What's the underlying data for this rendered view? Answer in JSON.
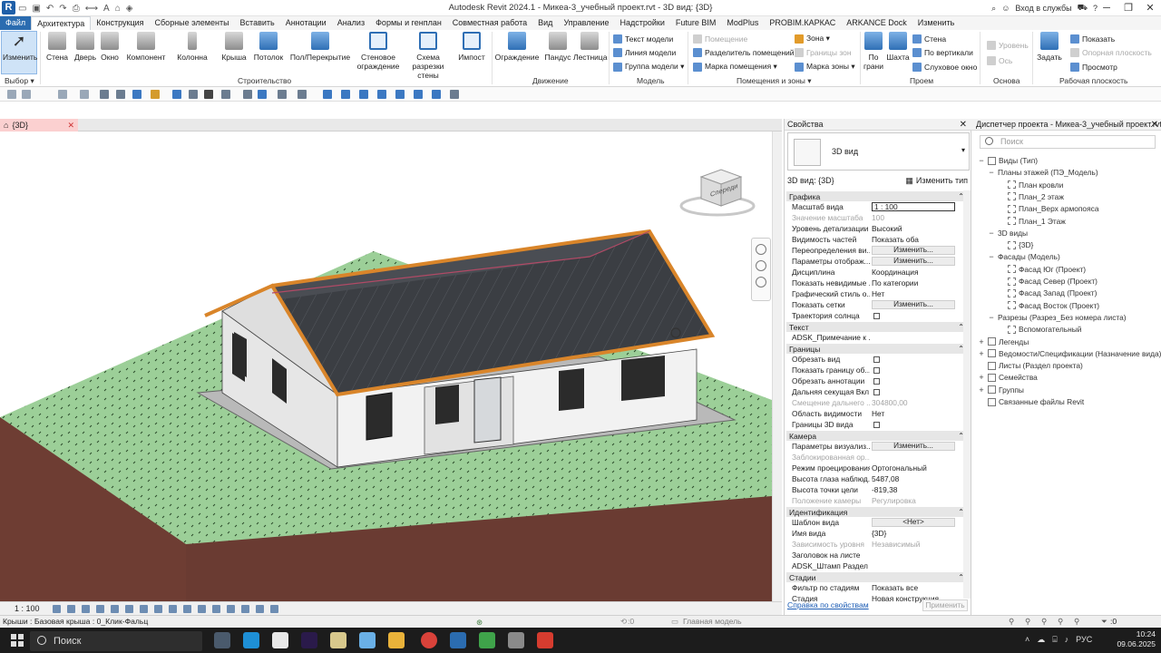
{
  "app": {
    "title": "Autodesk Revit 2024.1 - Микеа-3_учебный проект.rvt - 3D вид: {3D}",
    "logo": "R",
    "login": "Вход в службы",
    "help": "?"
  },
  "tabs": [
    "Файл",
    "Архитектура",
    "Конструкция",
    "Сборные элементы",
    "Вставить",
    "Аннотации",
    "Анализ",
    "Формы и генплан",
    "Совместная работа",
    "Вид",
    "Управление",
    "Надстройки",
    "Future BIM",
    "ModPlus",
    "PROBIM.КАРКАС",
    "ARKANCE Dock",
    "Изменить"
  ],
  "ribbon": {
    "select": {
      "modify": "Изменить",
      "select": "Выбор ▾"
    },
    "build": {
      "label": "Строительство",
      "buttons": [
        "Стена",
        "Дверь",
        "Окно",
        "Компонент",
        "Колонна",
        "Крыша",
        "Потолок",
        "Пол/Перекрытие",
        "Стеновое ограждение",
        "Схема разрезки стены",
        "Импост"
      ]
    },
    "circulation": {
      "label": "Движение",
      "buttons": [
        "Ограждение",
        "Пандус",
        "Лестница"
      ]
    },
    "model": {
      "label": "Модель",
      "items": [
        "Текст модели",
        "Линия модели",
        "Группа модели ▾"
      ]
    },
    "rooms": {
      "label": "Помещения и зоны ▾",
      "items": [
        "Помещение",
        "Разделитель помещений",
        "Марка помещения ▾",
        "Зона ▾",
        "Границы зон",
        "Марка зоны ▾"
      ]
    },
    "opening": {
      "label": "Проем",
      "bigbuttons": [
        "По грани",
        "Шахта"
      ],
      "items": [
        "Стена",
        "По вертикали",
        "Слуховое окно"
      ]
    },
    "datum": {
      "label": "Основа",
      "items": [
        "Уровень",
        "Ось"
      ]
    },
    "workplane": {
      "label": "Рабочая плоскость",
      "set": "Задать",
      "items": [
        "Показать",
        "Опорная плоскость",
        "Просмотр"
      ]
    }
  },
  "viewtab": {
    "label": "{3D}"
  },
  "viewcube": {
    "face": "Спереди"
  },
  "viewcontrol": {
    "scale": "1 : 100"
  },
  "properties": {
    "title": "Свойства",
    "type_name": "3D вид",
    "view_selector": "3D вид: {3D}",
    "edit_type": "Изменить тип",
    "sections": [
      {
        "name": "Графика",
        "rows": [
          {
            "n": "Масштаб вида",
            "v": "1 : 100",
            "k": "input"
          },
          {
            "n": "Значение масштаба",
            "v": "100",
            "k": "dis"
          },
          {
            "n": "Уровень детализации",
            "v": "Высокий",
            "k": "text"
          },
          {
            "n": "Видимость частей",
            "v": "Показать оба",
            "k": "text"
          },
          {
            "n": "Переопределения ви...",
            "v": "Изменить...",
            "k": "btn"
          },
          {
            "n": "Параметры отображ...",
            "v": "Изменить...",
            "k": "btn"
          },
          {
            "n": "Дисциплина",
            "v": "Координация",
            "k": "text"
          },
          {
            "n": "Показать невидимые ...",
            "v": "По категории",
            "k": "text"
          },
          {
            "n": "Графический стиль о...",
            "v": "Нет",
            "k": "text"
          },
          {
            "n": "Показать сетки",
            "v": "Изменить...",
            "k": "btn"
          },
          {
            "n": "Траектория солнца",
            "v": "",
            "k": "cb"
          }
        ]
      },
      {
        "name": "Текст",
        "rows": [
          {
            "n": "ADSK_Примечание к ...",
            "v": "",
            "k": "text"
          }
        ]
      },
      {
        "name": "Границы",
        "rows": [
          {
            "n": "Обрезать вид",
            "v": "",
            "k": "cb"
          },
          {
            "n": "Показать границу об...",
            "v": "",
            "k": "cb"
          },
          {
            "n": "Обрезать аннотации",
            "v": "",
            "k": "cb"
          },
          {
            "n": "Дальняя секущая Вкл",
            "v": "",
            "k": "cb"
          },
          {
            "n": "Смещение дальнего ...",
            "v": "304800,00",
            "k": "dis"
          },
          {
            "n": "Область видимости",
            "v": "Нет",
            "k": "text"
          },
          {
            "n": "Границы 3D вида",
            "v": "",
            "k": "cb"
          }
        ]
      },
      {
        "name": "Камера",
        "rows": [
          {
            "n": "Параметры визуализ...",
            "v": "Изменить...",
            "k": "btn"
          },
          {
            "n": "Заблокированная ор...",
            "v": "",
            "k": "dis"
          },
          {
            "n": "Режим проецирования",
            "v": "Ортогональный",
            "k": "text"
          },
          {
            "n": "Высота глаза наблюд...",
            "v": "5487,08",
            "k": "text"
          },
          {
            "n": "Высота точки цели",
            "v": "-819,38",
            "k": "text"
          },
          {
            "n": "Положение камеры",
            "v": "Регулировка",
            "k": "dis"
          }
        ]
      },
      {
        "name": "Идентификация",
        "rows": [
          {
            "n": "Шаблон вида",
            "v": "<Нет>",
            "k": "btn"
          },
          {
            "n": "Имя вида",
            "v": "{3D}",
            "k": "text"
          },
          {
            "n": "Зависимость уровня",
            "v": "Независимый",
            "k": "dis"
          },
          {
            "n": "Заголовок на листе",
            "v": "",
            "k": "text"
          },
          {
            "n": "ADSK_Штамп Раздел ...",
            "v": "",
            "k": "text"
          }
        ]
      },
      {
        "name": "Стадии",
        "rows": [
          {
            "n": "Фильтр по стадиям",
            "v": "Показать все",
            "k": "text"
          },
          {
            "n": "Стадия",
            "v": "Новая конструкция",
            "k": "text"
          }
        ]
      }
    ],
    "help_link": "Справка по свойствам",
    "apply": "Применить"
  },
  "browser": {
    "title": "Диспетчер проекта - Микеа-3_учебный проект.rvt",
    "search_placeholder": "Поиск",
    "nodes": [
      {
        "t": "Виды (Тип)",
        "lvl": 0,
        "tg": "−",
        "ic": true
      },
      {
        "t": "Планы этажей (ПЭ_Модель)",
        "lvl": 1,
        "tg": "−",
        "ic": false
      },
      {
        "t": "План кровли",
        "lvl": 2,
        "tg": "",
        "ic": true
      },
      {
        "t": "План_2 этаж",
        "lvl": 2,
        "tg": "",
        "ic": true
      },
      {
        "t": "План_Верх армопояса",
        "lvl": 2,
        "tg": "",
        "ic": true
      },
      {
        "t": "План_1 Этаж",
        "lvl": 2,
        "tg": "",
        "ic": true
      },
      {
        "t": "3D виды",
        "lvl": 1,
        "tg": "−",
        "ic": false
      },
      {
        "t": "{3D}",
        "lvl": 2,
        "tg": "",
        "ic": true
      },
      {
        "t": "Фасады (Модель)",
        "lvl": 1,
        "tg": "−",
        "ic": false
      },
      {
        "t": "Фасад Юг (Проект)",
        "lvl": 2,
        "tg": "",
        "ic": true
      },
      {
        "t": "Фасад Север (Проект)",
        "lvl": 2,
        "tg": "",
        "ic": true
      },
      {
        "t": "Фасад Запад (Проект)",
        "lvl": 2,
        "tg": "",
        "ic": true
      },
      {
        "t": "Фасад Восток (Проект)",
        "lvl": 2,
        "tg": "",
        "ic": true
      },
      {
        "t": "Разрезы (Разрез_Без номера листа)",
        "lvl": 1,
        "tg": "−",
        "ic": false
      },
      {
        "t": "Вспомогательный",
        "lvl": 2,
        "tg": "",
        "ic": true
      },
      {
        "t": "Легенды",
        "lvl": 0,
        "tg": "+",
        "ic": true
      },
      {
        "t": "Ведомости/Спецификации (Назначение вида)",
        "lvl": 0,
        "tg": "+",
        "ic": true
      },
      {
        "t": "Листы (Раздел проекта)",
        "lvl": 0,
        "tg": "",
        "ic": true
      },
      {
        "t": "Семейства",
        "lvl": 0,
        "tg": "+",
        "ic": true
      },
      {
        "t": "Группы",
        "lvl": 0,
        "tg": "+",
        "ic": true
      },
      {
        "t": "Связанные файлы Revit",
        "lvl": 0,
        "tg": "",
        "ic": true
      }
    ]
  },
  "status": {
    "text": "Крыши : Базовая крыша : 0_Клик-Фальц",
    "model": "Главная модель",
    "filter": ":0",
    "zero": ":0"
  },
  "taskbar": {
    "search": "Поиск",
    "lang": "РУС",
    "time": "10:24",
    "date": "09.06.2025"
  }
}
